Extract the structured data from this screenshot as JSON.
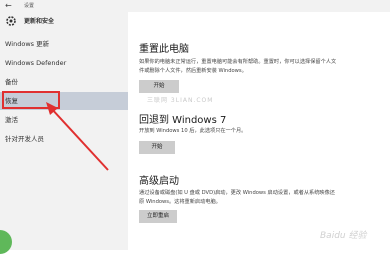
{
  "window": {
    "title": "设置",
    "back_icon": "back-arrow-icon"
  },
  "sidebar": {
    "header": {
      "icon": "gear-icon",
      "label": "更新和安全"
    },
    "items": [
      {
        "label": "Windows 更新",
        "selected": false
      },
      {
        "label": "Windows Defender",
        "selected": false
      },
      {
        "label": "备份",
        "selected": false
      },
      {
        "label": "恢复",
        "selected": true
      },
      {
        "label": "激活",
        "selected": false
      },
      {
        "label": "针对开发人员",
        "selected": false
      }
    ]
  },
  "main": {
    "reset": {
      "title": "重置此电脑",
      "description": "如果你的电脑未正常运行，重置电脑可能会有所帮助。重置时，你可以选择保留个人文件或删除个人文件，然后重新安装 Windows。",
      "button": "开始"
    },
    "goback": {
      "title": "回退到 Windows 7",
      "description": "开放到 Windows 10 后，此选项只在一个月。",
      "button": "开始"
    },
    "advanced": {
      "title": "高级启动",
      "description": "通过设备或磁盘(如 U 盘或 DVD)启动，更改 Windows 启动设置，或者从系统映像还原 Windows。这将重新启动电脑。",
      "button": "立即重启"
    }
  },
  "watermarks": {
    "site": "三联网 3LIAN.COM",
    "brand": "Baidu 经验"
  },
  "colors": {
    "selection": "#c6cdd8",
    "highlight": "#e03030",
    "sidebar_bg": "#f2f2f2"
  }
}
